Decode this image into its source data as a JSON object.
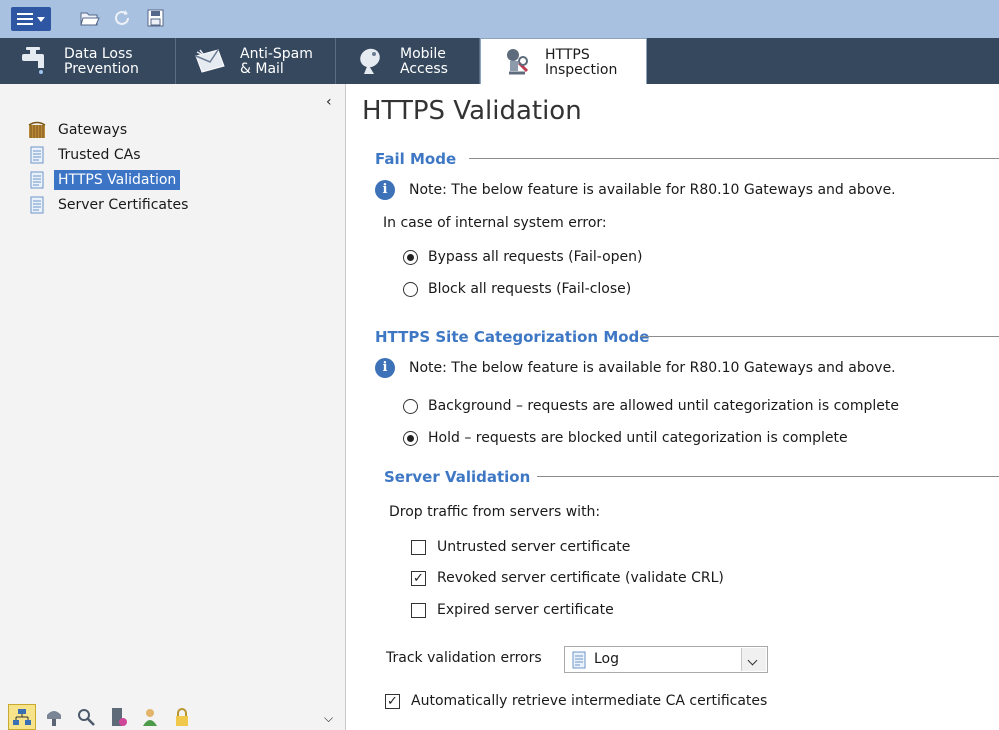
{
  "toolbar": {
    "menu_icon": "menu-icon",
    "open_icon": "folder-open-icon",
    "refresh_icon": "refresh-icon",
    "save_icon": "save-icon"
  },
  "tabs": [
    {
      "label": "Data Loss\nPrevention",
      "icon": "faucet-icon"
    },
    {
      "label": "Anti-Spam\n& Mail",
      "icon": "mail-icon"
    },
    {
      "label": "Mobile\nAccess",
      "icon": "satellite-dish-icon"
    },
    {
      "label": "HTTPS\nInspection",
      "icon": "inspector-icon",
      "active": true
    }
  ],
  "tree": [
    {
      "label": "Gateways",
      "icon": "gateway-icon"
    },
    {
      "label": "Trusted CAs",
      "icon": "page-icon"
    },
    {
      "label": "HTTPS Validation",
      "icon": "page-icon",
      "selected": true
    },
    {
      "label": "Server Certificates",
      "icon": "page-icon"
    }
  ],
  "page": {
    "title": "HTTPS Validation",
    "fail_mode": {
      "heading": "Fail Mode",
      "note": "Note: The below feature is available for R80.10 Gateways and above.",
      "prompt": "In case of internal system error:",
      "options": [
        {
          "label": "Bypass all requests (Fail-open)",
          "selected": true
        },
        {
          "label": "Block all requests (Fail-close)",
          "selected": false
        }
      ]
    },
    "categorization": {
      "heading": "HTTPS Site Categorization Mode",
      "note": "Note: The below feature is available for R80.10 Gateways and above.",
      "options": [
        {
          "label": "Background – requests are allowed until categorization is complete",
          "selected": false
        },
        {
          "label": "Hold – requests are blocked until categorization is complete",
          "selected": true
        }
      ]
    },
    "server_validation": {
      "heading": "Server Validation",
      "prompt": "Drop traffic from servers with:",
      "checks": [
        {
          "label": "Untrusted server certificate",
          "checked": false
        },
        {
          "label": "Revoked server certificate (validate CRL)",
          "checked": true
        },
        {
          "label": "Expired server certificate",
          "checked": false
        }
      ],
      "track_label": "Track validation errors",
      "track_value": "Log",
      "auto_retrieve": {
        "label": "Automatically retrieve intermediate CA certificates",
        "checked": true
      }
    }
  }
}
